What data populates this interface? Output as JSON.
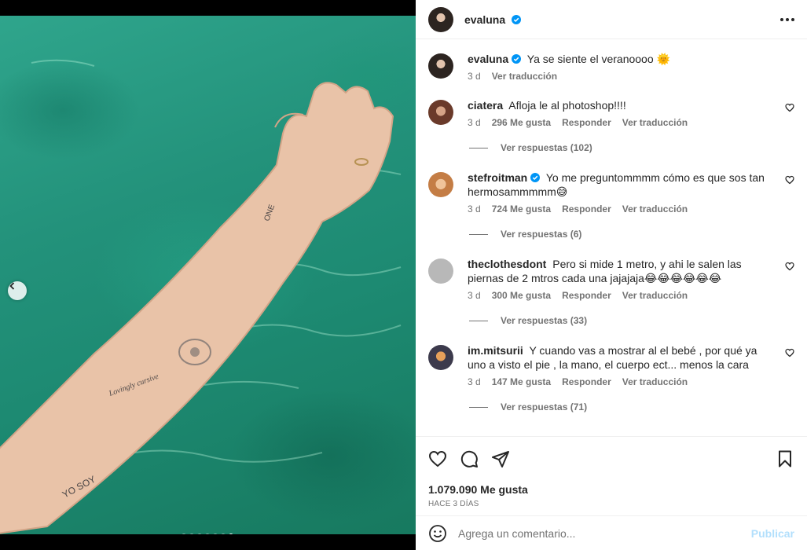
{
  "post": {
    "username": "evaluna",
    "caption": "Ya se siente el veranoooo 🌞",
    "caption_time": "3 d",
    "translate_label": "Ver traducción",
    "likes": "1.079.090 Me gusta",
    "date": "HACE 3 DÍAS",
    "carousel": {
      "slides": 7,
      "active_index": 6
    }
  },
  "comments": [
    {
      "username": "ciatera",
      "verified": false,
      "text": "Afloja le al photoshop!!!!",
      "time": "3 d",
      "likes": "296 Me gusta",
      "reply_label": "Responder",
      "translate_label": "Ver traducción",
      "replies": "Ver respuestas (102)"
    },
    {
      "username": "stefroitman",
      "verified": true,
      "text": "Yo me preguntommmm cómo es que sos tan hermosammmmm😅",
      "time": "3 d",
      "likes": "724 Me gusta",
      "reply_label": "Responder",
      "translate_label": "Ver traducción",
      "replies": "Ver respuestas (6)"
    },
    {
      "username": "theclothesdont",
      "verified": false,
      "text": "Pero si mide 1 metro, y ahi le salen las piernas de 2 mtros cada una jajajaja😂😂😂😂😂😂",
      "time": "3 d",
      "likes": "300 Me gusta",
      "reply_label": "Responder",
      "translate_label": "Ver traducción",
      "replies": "Ver respuestas (33)"
    },
    {
      "username": "im.mitsurii",
      "verified": false,
      "text": "Y cuando vas a mostrar al el bebé , por qué ya uno a visto el pie , la mano, el cuerpo ect... menos la cara",
      "time": "3 d",
      "likes": "147 Me gusta",
      "reply_label": "Responder",
      "translate_label": "Ver traducción",
      "replies": "Ver respuestas (71)"
    }
  ],
  "composer": {
    "placeholder": "Agrega un comentario...",
    "publish_label": "Publicar"
  },
  "photo": {
    "tattoo_one": "ONE",
    "tattoo_script": "Lovingly cursive",
    "tattoo_yosoy": "YO SOY"
  },
  "colors": {
    "verified_blue": "#0095f6",
    "muted_text": "#737373",
    "publish_disabled": "#b2dffc",
    "water": "#23927b"
  },
  "icons": [
    "verified-icon",
    "more-options-icon",
    "heart-icon",
    "comment-icon",
    "share-icon",
    "bookmark-icon",
    "emoji-icon",
    "chevron-left-icon"
  ]
}
